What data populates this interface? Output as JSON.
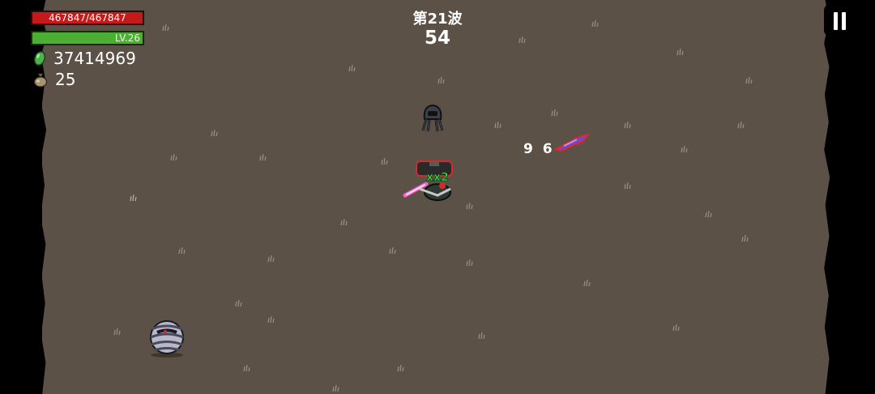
{
  "hud": {
    "hp_text": "467847/467847",
    "level_text": "LV.26",
    "gems": "37414969",
    "bags": "25"
  },
  "wave": {
    "title": "第21波",
    "timer": "54"
  },
  "combat": {
    "damage_number": "9 6"
  },
  "icons": {
    "gem": "green-gem-icon",
    "bag": "money-bag-icon",
    "pause": "pause-icon"
  },
  "colors": {
    "hp": "#c41a1a",
    "xp": "#4caf33",
    "ground": "#5c5146"
  }
}
